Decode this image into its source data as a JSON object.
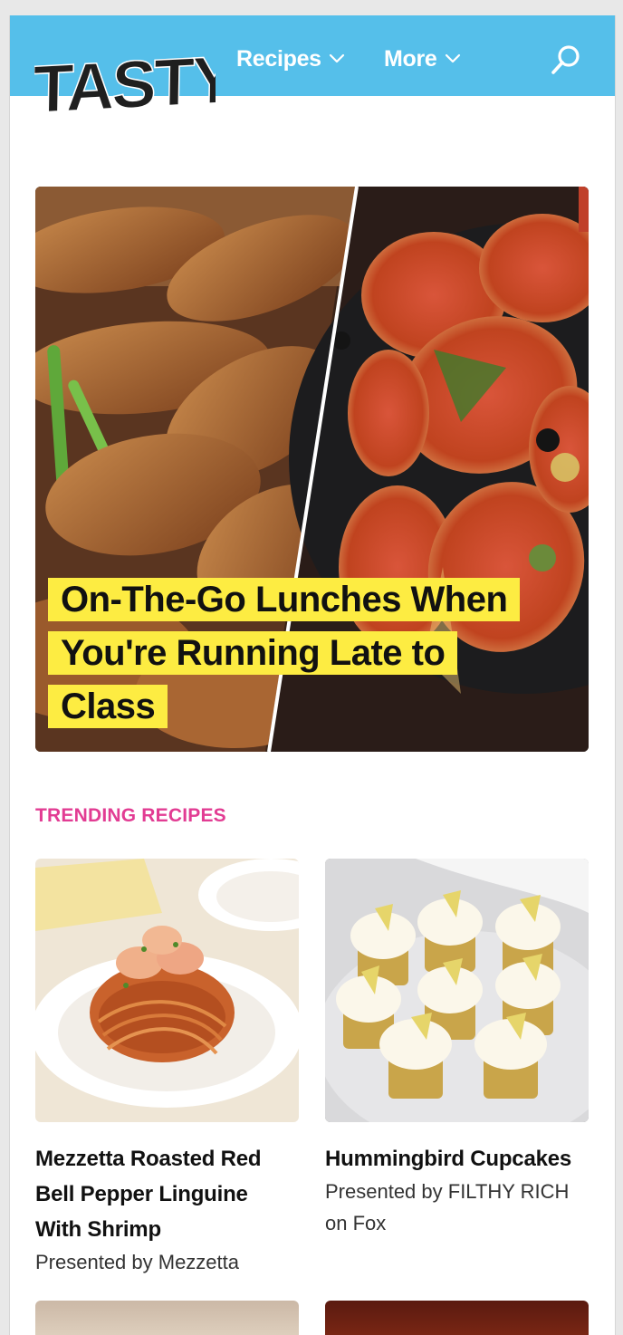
{
  "header": {
    "logo_text": "TASTY",
    "nav": [
      {
        "label": "Recipes"
      },
      {
        "label": "More"
      }
    ],
    "colors": {
      "background": "#55bfea",
      "text": "#ffffff"
    }
  },
  "hero": {
    "title": "On-The-Go Lunches When You're Running Late to Class",
    "highlight_color": "#fdec42"
  },
  "trending": {
    "label": "TRENDING RECIPES",
    "label_color": "#e23c93",
    "cards": [
      {
        "title": "Mezzetta Roasted Red Bell Pepper Linguine With Shrimp",
        "presenter": "Presented by Mezzetta"
      },
      {
        "title": "Hummingbird Cupcakes",
        "presenter": "Presented by FILTHY RICH on Fox"
      }
    ]
  }
}
